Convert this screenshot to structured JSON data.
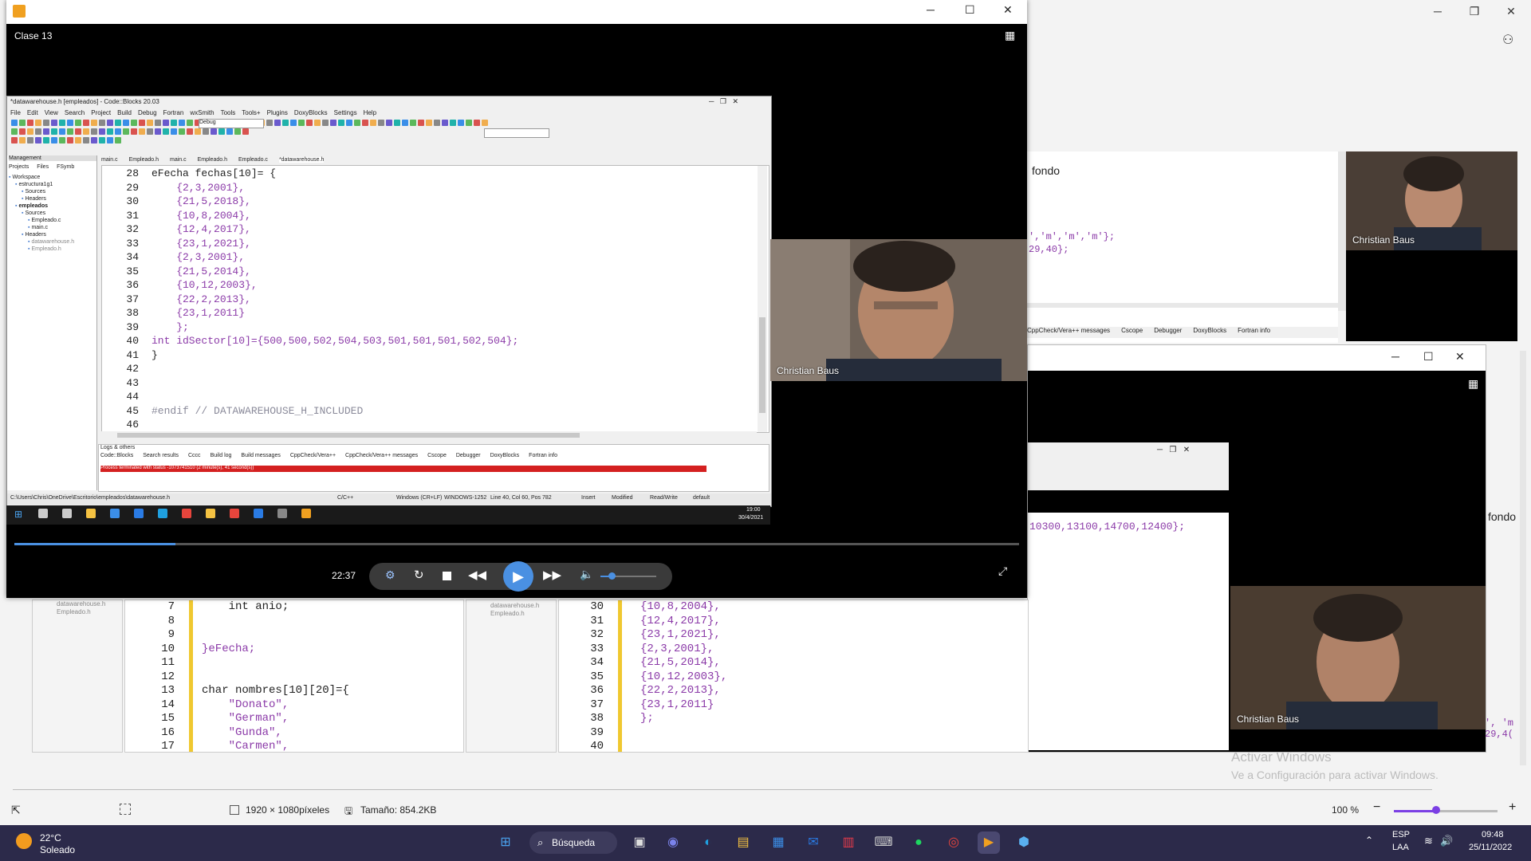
{
  "viewer": {
    "footer_dimensions": "1920 × 1080píxeles",
    "footer_size": "Tamaño: 854.2KB",
    "zoom": "100 %",
    "activate_title": "Activar Windows",
    "activate_sub": "Ve a Configuración para activar Windows."
  },
  "player": {
    "title": "Clase 13",
    "time": "22:37",
    "progress_fraction": 0.16,
    "volume_fraction": 0.2
  },
  "codeblocks": {
    "title": "*datawarehouse.h [empleados] - Code::Blocks 20.03",
    "menu": [
      "File",
      "Edit",
      "View",
      "Search",
      "Project",
      "Build",
      "Debug",
      "Fortran",
      "wxSmith",
      "Tools",
      "Tools+",
      "Plugins",
      "DoxyBlocks",
      "Settings",
      "Help"
    ],
    "build_target": "Debug",
    "tabs": [
      "main.c",
      "Empleado.h",
      "main.c",
      "Empleado.h",
      "Empleado.c",
      "*datawarehouse.h"
    ],
    "mgmt_title": "Management",
    "mgmt_tabs": [
      "Projects",
      "Files",
      "FSymb"
    ],
    "tree": [
      "Workspace",
      "estructura1g1",
      "Sources",
      "Headers",
      "empleados",
      "Sources",
      "Empleado.c",
      "main.c",
      "Headers",
      "datawarehouse.h",
      "Empleado.h"
    ],
    "code": [
      {
        "n": "28",
        "t": "eFecha fechas[10]= {"
      },
      {
        "n": "29",
        "t": "    {2,3,2001},"
      },
      {
        "n": "30",
        "t": "    {21,5,2018},"
      },
      {
        "n": "31",
        "t": "    {10,8,2004},"
      },
      {
        "n": "32",
        "t": "    {12,4,2017},"
      },
      {
        "n": "33",
        "t": "    {23,1,2021},"
      },
      {
        "n": "34",
        "t": "    {2,3,2001},"
      },
      {
        "n": "35",
        "t": "    {21,5,2014},"
      },
      {
        "n": "36",
        "t": "    {10,12,2003},"
      },
      {
        "n": "37",
        "t": "    {22,2,2013},"
      },
      {
        "n": "38",
        "t": "    {23,1,2011}"
      },
      {
        "n": "39",
        "t": "    };"
      },
      {
        "n": "40",
        "t": "int idSector[10]={500,500,502,504,503,501,501,501,502,504};"
      },
      {
        "n": "41",
        "t": "}"
      },
      {
        "n": "42",
        "t": ""
      },
      {
        "n": "43",
        "t": ""
      },
      {
        "n": "44",
        "t": ""
      },
      {
        "n": "45",
        "t": "#endif // DATAWAREHOUSE_H_INCLUDED"
      },
      {
        "n": "46",
        "t": ""
      }
    ],
    "logs_title": "Logs & others",
    "log_tabs": [
      "Code::Blocks",
      "Search results",
      "Cccc",
      "Build log",
      "Build messages",
      "CppCheck/Vera++",
      "CppCheck/Vera++ messages",
      "Cscope",
      "Debugger",
      "DoxyBlocks",
      "Fortran info"
    ],
    "log_error": "Process terminated with status -1073741510 (2 minute(s), 41 second(s))",
    "status": [
      "C:\\Users\\Chris\\OneDrive\\Escritorio\\empleados\\datawarehouse.h",
      "C/C++",
      "Windows (CR+LF)",
      "WINDOWS-1252",
      "Line 40, Col 60, Pos 782",
      "Insert",
      "Modified",
      "Read/Write",
      "default"
    ],
    "clock_time": "19:00",
    "clock_date": "30/4/2021"
  },
  "cams": {
    "main_name": "Christian Baus",
    "top_right_name": "Christian Baus",
    "bottom_right_name": "Christian Baus"
  },
  "bg": {
    "fondo_1": "fondo",
    "fondo_2": "fondo",
    "frag_chars": "','m','m','m'};",
    "frag_nums": "29,40};",
    "frag_row": "10300,13100,14700,12400};",
    "frag_m": "', 'm",
    "frag_m2": "29,4(",
    "bg_tabs": [
      "CppCheck/Vera++ messages",
      "Cscope",
      "Debugger",
      "DoxyBlocks",
      "Fortran info"
    ],
    "left_code": [
      {
        "n": "7",
        "t": "    int anio;"
      },
      {
        "n": "8",
        "t": ""
      },
      {
        "n": "9",
        "t": ""
      },
      {
        "n": "10",
        "t": "}eFecha;"
      },
      {
        "n": "11",
        "t": ""
      },
      {
        "n": "12",
        "t": ""
      },
      {
        "n": "13",
        "t": "char nombres[10][20]={"
      },
      {
        "n": "14",
        "t": "    \"Donato\","
      },
      {
        "n": "15",
        "t": "    \"German\","
      },
      {
        "n": "16",
        "t": "    \"Gunda\","
      },
      {
        "n": "17",
        "t": "    \"Carmen\","
      }
    ],
    "right_code": [
      {
        "n": "30",
        "t": "{10,8,2004},"
      },
      {
        "n": "31",
        "t": "{12,4,2017},"
      },
      {
        "n": "32",
        "t": "{23,1,2021},"
      },
      {
        "n": "33",
        "t": "{2,3,2001},"
      },
      {
        "n": "34",
        "t": "{21,5,2014},"
      },
      {
        "n": "35",
        "t": "{10,12,2003},"
      },
      {
        "n": "36",
        "t": "{22,2,2013},"
      },
      {
        "n": "37",
        "t": "{23,1,2011}"
      },
      {
        "n": "38",
        "t": "};"
      },
      {
        "n": "39",
        "t": ""
      },
      {
        "n": "40",
        "t": ""
      }
    ],
    "left_tree": [
      "datawarehouse.h",
      "Empleado.h"
    ],
    "mid_tree": [
      "datawarehouse.h",
      "Empleado.h"
    ]
  },
  "taskbar": {
    "weather_temp": "22°C",
    "weather_desc": "Soleado",
    "search_label": "Búsqueda",
    "lang_1": "ESP",
    "lang_2": "LAA",
    "time": "09:48",
    "date": "25/11/2022"
  }
}
